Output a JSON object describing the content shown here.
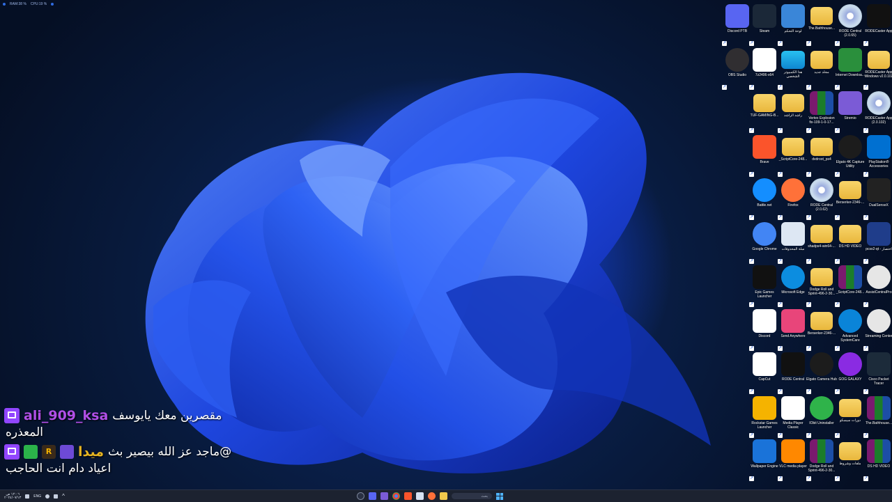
{
  "performance": {
    "ram": "RAM:38 %",
    "cpu": "CPU:19 %"
  },
  "desktop_icons": [
    {
      "label": "Discord PTB",
      "icon": "discord-icon",
      "color": "#5865f2"
    },
    {
      "label": "Steam",
      "icon": "steam-icon",
      "color": "#1b2838"
    },
    {
      "label": "لوحة التحكم",
      "icon": "control-panel-icon",
      "color": "#3a86d8"
    },
    {
      "label": "The.Bathhouse...",
      "icon": "folder-icon",
      "color": "#f2c94c"
    },
    {
      "label": "RODE Central (2.0.65)",
      "icon": "disc-icon",
      "color": "#cfe6f0"
    },
    {
      "label": "RODECaster App",
      "icon": "rodecaster-icon",
      "color": "#111111"
    },
    {
      "label": "OBS Studio",
      "icon": "obs-icon",
      "color": "#302e31"
    },
    {
      "label": "7z2406-x64",
      "icon": "7zip-icon",
      "color": "#ffffff"
    },
    {
      "label": "هذا الكمبيوتر الشخصي",
      "icon": "this-pc-icon",
      "color": "#1ea5e9"
    },
    {
      "label": "مجلد جديد",
      "icon": "folder-icon",
      "color": "#f2c94c"
    },
    {
      "label": "Internet Downloa...",
      "icon": "idm-icon",
      "color": "#2a8f3c"
    },
    {
      "label": "RODECaster App Windows v2.0.102",
      "icon": "folder-icon",
      "color": "#f2c94c"
    },
    {
      "label": "TUF-GAMING-B...",
      "icon": "folder-icon",
      "color": "#f2c94c"
    },
    {
      "label": "راشد الراشد",
      "icon": "user-folder-icon",
      "color": "#e9b73c"
    },
    {
      "label": "Vertex Explosion fix-109-1-0-17...",
      "icon": "winrar-icon",
      "color": "#7a1a6e"
    },
    {
      "label": "Stremio",
      "icon": "stremio-icon",
      "color": "#7b5bd6"
    },
    {
      "label": "RODECaster App (2.0.102)",
      "icon": "disc-icon",
      "color": "#cfe6f0"
    },
    {
      "label": "Brave",
      "icon": "brave-icon",
      "color": "#fb542b"
    },
    {
      "label": "_ScriptCore-248...",
      "icon": "folder-icon",
      "color": "#f2c94c"
    },
    {
      "label": "dvdroot_ps4",
      "icon": "folder-icon",
      "color": "#f2c94c"
    },
    {
      "label": "Elgato 4K Capture Utility",
      "icon": "elgato-4k-icon",
      "color": "#1c1c1c"
    },
    {
      "label": "PlayStation® Accessories",
      "icon": "playstation-icon",
      "color": "#0070d1"
    },
    {
      "label": "Battle.net",
      "icon": "battlenet-icon",
      "color": "#148eff"
    },
    {
      "label": "Firefox",
      "icon": "firefox-icon",
      "color": "#ff7139"
    },
    {
      "label": "RODE Central (2.0.62)",
      "icon": "disc-icon",
      "color": "#cfe6f0"
    },
    {
      "label": "Berserker-2346-...",
      "icon": "folder-icon",
      "color": "#f2c94c"
    },
    {
      "label": "DualSenseX",
      "icon": "dualsensex-icon",
      "color": "#222222"
    },
    {
      "label": "Google Chrome",
      "icon": "chrome-icon",
      "color": "#4285f4"
    },
    {
      "label": "سلة المحذوفات",
      "icon": "recycle-bin-icon",
      "color": "#dde7f3"
    },
    {
      "label": "shadps4-win64-...",
      "icon": "folder-icon",
      "color": "#f2c94c"
    },
    {
      "label": "DS HD VIDEO",
      "icon": "folder-icon",
      "color": "#f2c94c"
    },
    {
      "label": "pcsx2-qt - اختصار",
      "icon": "pcsx2-icon",
      "color": "#1f3d8a"
    },
    {
      "label": "Epic Games Launcher",
      "icon": "epic-games-icon",
      "color": "#111111"
    },
    {
      "label": "Microsoft Edge",
      "icon": "edge-icon",
      "color": "#0c8de0"
    },
    {
      "label": "Dodge Roll and Sprint-496-2-30...",
      "icon": "folder-icon",
      "color": "#f2c94c"
    },
    {
      "label": "_ScriptCore-248...",
      "icon": "winrar-icon",
      "color": "#7a1a6e"
    },
    {
      "label": "AssistCentralPro",
      "icon": "assist-icon",
      "color": "#e6e6e6"
    },
    {
      "label": "Discord",
      "icon": "file-icon",
      "color": "#ffffff"
    },
    {
      "label": "Send Anywhere",
      "icon": "send-anywhere-icon",
      "color": "#e8457a"
    },
    {
      "label": "Berserker-2346-...",
      "icon": "folder-icon",
      "color": "#f2c94c"
    },
    {
      "label": "Advanced SystemCare",
      "icon": "advanced-systemcare-icon",
      "color": "#0a84d8"
    },
    {
      "label": "Streaming Center",
      "icon": "assist-icon",
      "color": "#e6e6e6"
    },
    {
      "label": "CapCut",
      "icon": "capcut-icon",
      "color": "#ffffff"
    },
    {
      "label": "RODE Central",
      "icon": "rode-icon",
      "color": "#111111"
    },
    {
      "label": "Elgato Camera Hub",
      "icon": "elgato-camera-icon",
      "color": "#1c1c1c"
    },
    {
      "label": "GOG GALAXY",
      "icon": "gog-icon",
      "color": "#8a2be2"
    },
    {
      "label": "Cisco Packet Tracer",
      "icon": "packet-tracer-icon",
      "color": "#1c2b3a"
    },
    {
      "label": "Rockstar Games Launcher",
      "icon": "rockstar-icon",
      "color": "#f5b300"
    },
    {
      "label": "Media Player Classic",
      "icon": "mpc-icon",
      "color": "#ffffff"
    },
    {
      "label": "IObit Uninstaller",
      "icon": "iobit-icon",
      "color": "#2fb34a"
    },
    {
      "label": "دورات سيسكو",
      "icon": "folder-icon",
      "color": "#f2c94c"
    },
    {
      "label": "The.Bathhouse...",
      "icon": "winrar-icon",
      "color": "#7a1a6e"
    },
    {
      "label": "Wallpaper Engine",
      "icon": "wallpaper-engine-icon",
      "color": "#1a73d9"
    },
    {
      "label": "VLC media player",
      "icon": "vlc-icon",
      "color": "#ff8800"
    },
    {
      "label": "Dodge Roll and Sprint-496-2-30...",
      "icon": "winrar-icon",
      "color": "#7a1a6e"
    },
    {
      "label": "ملفات وشروط",
      "icon": "folder-icon",
      "color": "#f2c94c"
    },
    {
      "label": "DS HD VIDEO",
      "icon": "winrar-icon",
      "color": "#7a1a6e"
    }
  ],
  "chat": {
    "message1": {
      "username": "ali_909_ksa",
      "text": "مقصرين معك يايوسف",
      "continuation": "المعذره"
    },
    "message2": {
      "username": "ميدا",
      "text": "ماجد عز الله بيصير بث@",
      "continuation": "اعياد دام انت الحاجب"
    }
  },
  "taskbar": {
    "clock_time": "١٢:٠٦ ص",
    "clock_date": "٢٠٢٤/٠٧/١٣",
    "language": "ENG",
    "search_placeholder": "بحث"
  }
}
